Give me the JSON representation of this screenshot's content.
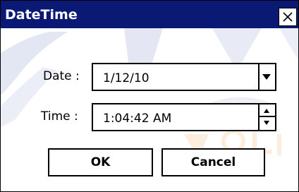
{
  "window": {
    "title": "DateTime",
    "close_icon": "close-icon"
  },
  "form": {
    "date_label": "Date :",
    "date_value": "1/12/10",
    "time_label": "Time :",
    "time_value": "1:04:42 AM"
  },
  "buttons": {
    "ok_label": "OK",
    "cancel_label": "Cancel"
  },
  "colors": {
    "titlebar": "#0a1a74",
    "window_bg": "#ffffff",
    "border": "#000000"
  }
}
